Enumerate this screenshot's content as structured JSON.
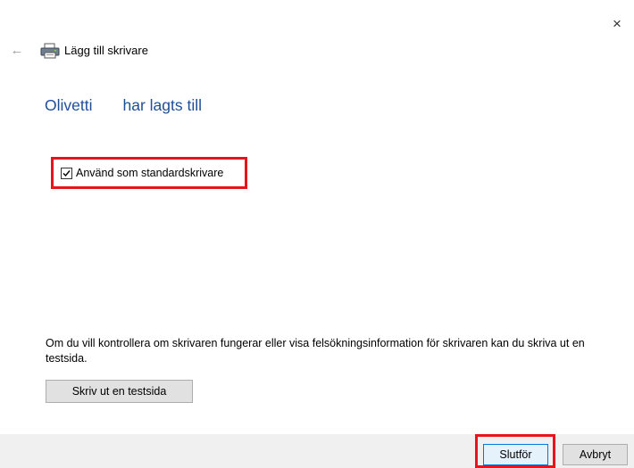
{
  "window": {
    "title": "Lägg till skrivare",
    "close_glyph": "×",
    "back_glyph": "←",
    "icon": "printer-icon"
  },
  "main": {
    "heading": "Olivetti       har lagts till",
    "default_printer": {
      "label": "Använd som standardskrivare",
      "checked": true
    },
    "info_text": "Om du vill kontrollera om skrivaren fungerar eller visa felsökningsinformation för skrivaren kan du skriva ut en testsida.",
    "test_page_button": "Skriv ut en testsida"
  },
  "footer": {
    "finish_button": "Slutför",
    "cancel_button": "Avbryt"
  },
  "colors": {
    "heading": "#1f4e99",
    "highlight": "#e8141c",
    "footer_bg": "#f0f0f0",
    "default_button_border": "#0078d7"
  }
}
